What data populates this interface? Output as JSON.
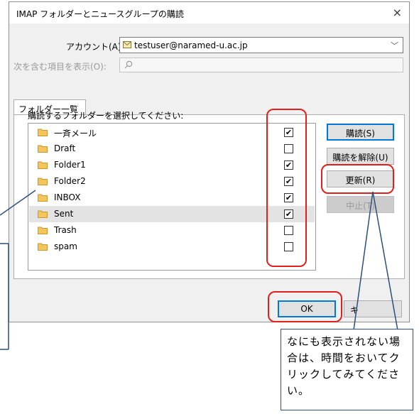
{
  "dialog": {
    "title": "IMAP フォルダーとニュースグループの購読",
    "close_symbol": "×"
  },
  "account": {
    "label": "アカウント(A):",
    "value": "testuser@naramed-u.ac.jp"
  },
  "filter": {
    "label": "次を含む項目を表示(O):",
    "value": ""
  },
  "tab": {
    "label": "フォルダー一覧(L)"
  },
  "list": {
    "heading": "購読するフォルダーを選択してください:",
    "folders": [
      {
        "name": "一斉メール",
        "subscribed": "✔"
      },
      {
        "name": "Draft",
        "subscribed": ""
      },
      {
        "name": "Folder1",
        "subscribed": "✔"
      },
      {
        "name": "Folder2",
        "subscribed": "✔"
      },
      {
        "name": "INBOX",
        "subscribed": "✔"
      },
      {
        "name": "Sent",
        "subscribed": "✔"
      },
      {
        "name": "Trash",
        "subscribed": ""
      },
      {
        "name": "spam",
        "subscribed": ""
      }
    ]
  },
  "buttons": {
    "subscribe": "購読(S)",
    "unsubscribe": "購読を解除(U)",
    "refresh": "更新(R)",
    "stop": "中止(T)",
    "ok": "OK",
    "cancel": "キ"
  },
  "callout": {
    "text": "なにも表示されない場合は、時間をおいてクリックしてみてください。"
  },
  "colors": {
    "highlight": "#e0201c",
    "callout_border": "#2c4f7c",
    "folder": "#f3c55b"
  }
}
